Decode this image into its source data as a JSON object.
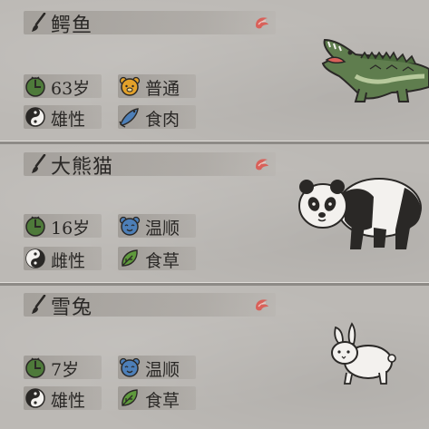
{
  "animals": [
    {
      "name": "鳄鱼",
      "age": "63岁",
      "temperament": "普通",
      "gender": "雄性",
      "diet": "食肉",
      "portrait_icon": "crocodile-illustration",
      "temperament_icon": "bear-face-icon",
      "gender_icon": "yin-yang-icon",
      "diet_icon": "fish-icon"
    },
    {
      "name": "大熊猫",
      "age": "16岁",
      "temperament": "温顺",
      "gender": "雌性",
      "diet": "食草",
      "portrait_icon": "panda-illustration",
      "temperament_icon": "smile-face-icon",
      "gender_icon": "yin-yang-dark-icon",
      "diet_icon": "leaf-icon"
    },
    {
      "name": "雪兔",
      "age": "7岁",
      "temperament": "温顺",
      "gender": "雄性",
      "diet": "食草",
      "portrait_icon": "rabbit-illustration",
      "temperament_icon": "smile-face-icon",
      "gender_icon": "yin-yang-icon",
      "diet_icon": "leaf-icon"
    }
  ],
  "colors": {
    "edit_icon": "#d9615a",
    "age_icon": "#4e7a3a",
    "normal_temper_icon": "#e3a12a",
    "gentle_temper_icon": "#4d7fb8",
    "diet_meat_icon": "#4d7fb8",
    "diet_plant_icon": "#5f9a3c"
  }
}
